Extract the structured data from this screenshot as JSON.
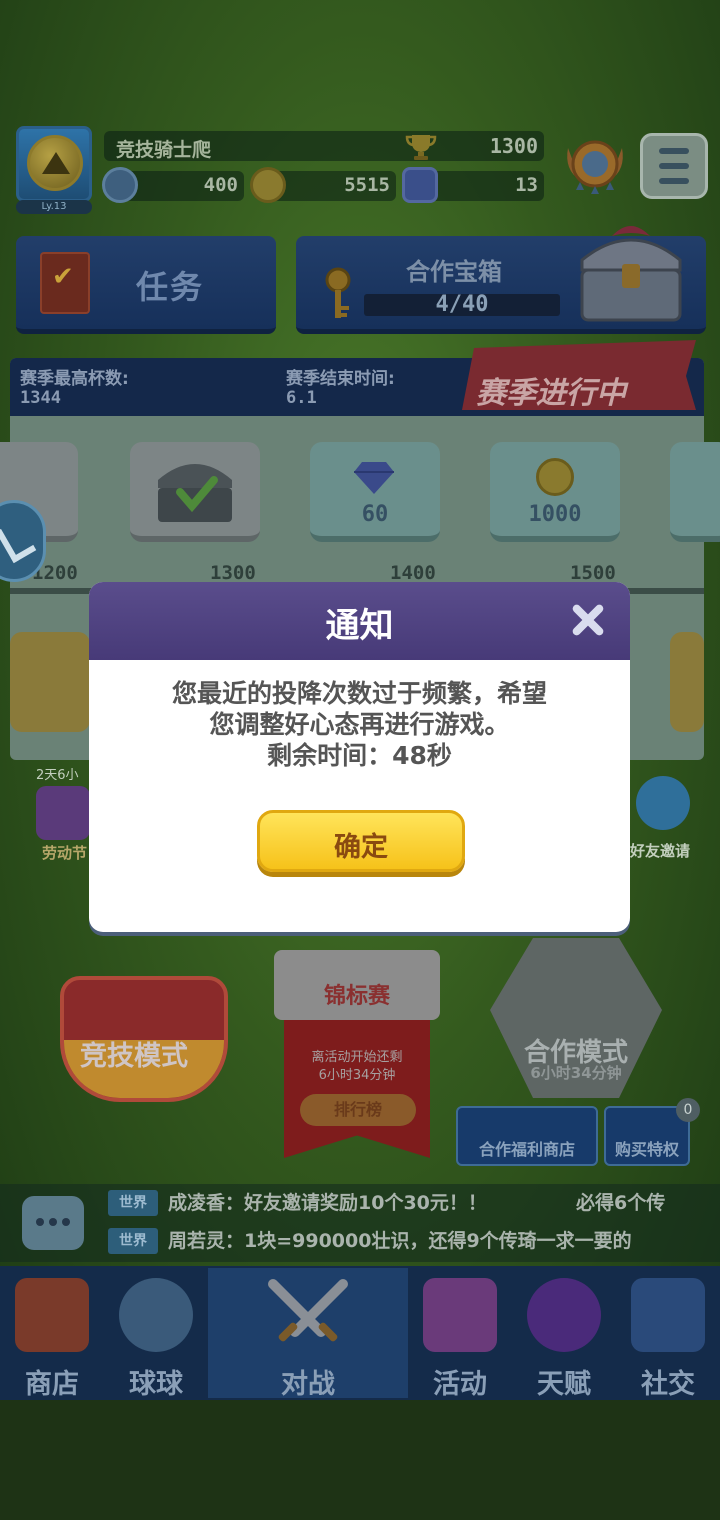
{
  "player": {
    "level": "Ly.13",
    "name": "竞技骑士爬",
    "trophies": "1300",
    "stars": "400",
    "coins": "5515",
    "gems": "13"
  },
  "tasks": {
    "label": "任务"
  },
  "coop_chest": {
    "title": "合作宝箱",
    "progress": "4/40",
    "progress_fraction": 0.1
  },
  "season": {
    "best_label": "赛季最高杯数:",
    "best_value": "1344",
    "end_label": "赛季结束时间:",
    "end_value": "6.1",
    "status": "赛季进行中",
    "rewards": [
      {
        "amount": "",
        "type": "claimed-chest"
      },
      {
        "amount": "60",
        "type": "gem"
      },
      {
        "amount": "1000",
        "type": "gold"
      }
    ],
    "ticks": [
      "1200",
      "1300",
      "1400",
      "1500"
    ]
  },
  "side": {
    "left_timer": "2天6小",
    "left_event": "劳动节",
    "right_label": "好友邀请"
  },
  "modes": {
    "ranked": "竞技模式",
    "tournament": {
      "label": "锦标赛",
      "line1": "离活动开始还剩",
      "line2": "6小时34分钟",
      "rank_button": "排行榜"
    },
    "coop": {
      "label": "合作模式",
      "sub": "6小时34分钟"
    }
  },
  "shop_chips": {
    "coop_shop": "合作福利商店",
    "buy_pass": "购买特权",
    "badge": "0"
  },
  "chat": {
    "messages": [
      {
        "tag": "世界",
        "text": "成凌香：好友邀请奖励10个30元！！",
        "extra": "必得6个传"
      },
      {
        "tag": "世界",
        "text": "周若灵：1块=990000壮识，还得9个传琦一求一要的"
      }
    ]
  },
  "nav": [
    {
      "label": "商店",
      "icon": "shop-icon"
    },
    {
      "label": "球球",
      "icon": "ball-icon"
    },
    {
      "label": "对战",
      "icon": "swords-icon"
    },
    {
      "label": "活动",
      "icon": "party-popper-icon"
    },
    {
      "label": "天赋",
      "icon": "talent-orb-icon"
    },
    {
      "label": "社交",
      "icon": "social-heart-icon"
    }
  ],
  "dialog": {
    "title": "通知",
    "line1": "您最近的投降次数过于频繁，希望",
    "line2": "您调整好心态再进行游戏。",
    "line3": "剩余时间：48秒",
    "confirm": "确定"
  }
}
